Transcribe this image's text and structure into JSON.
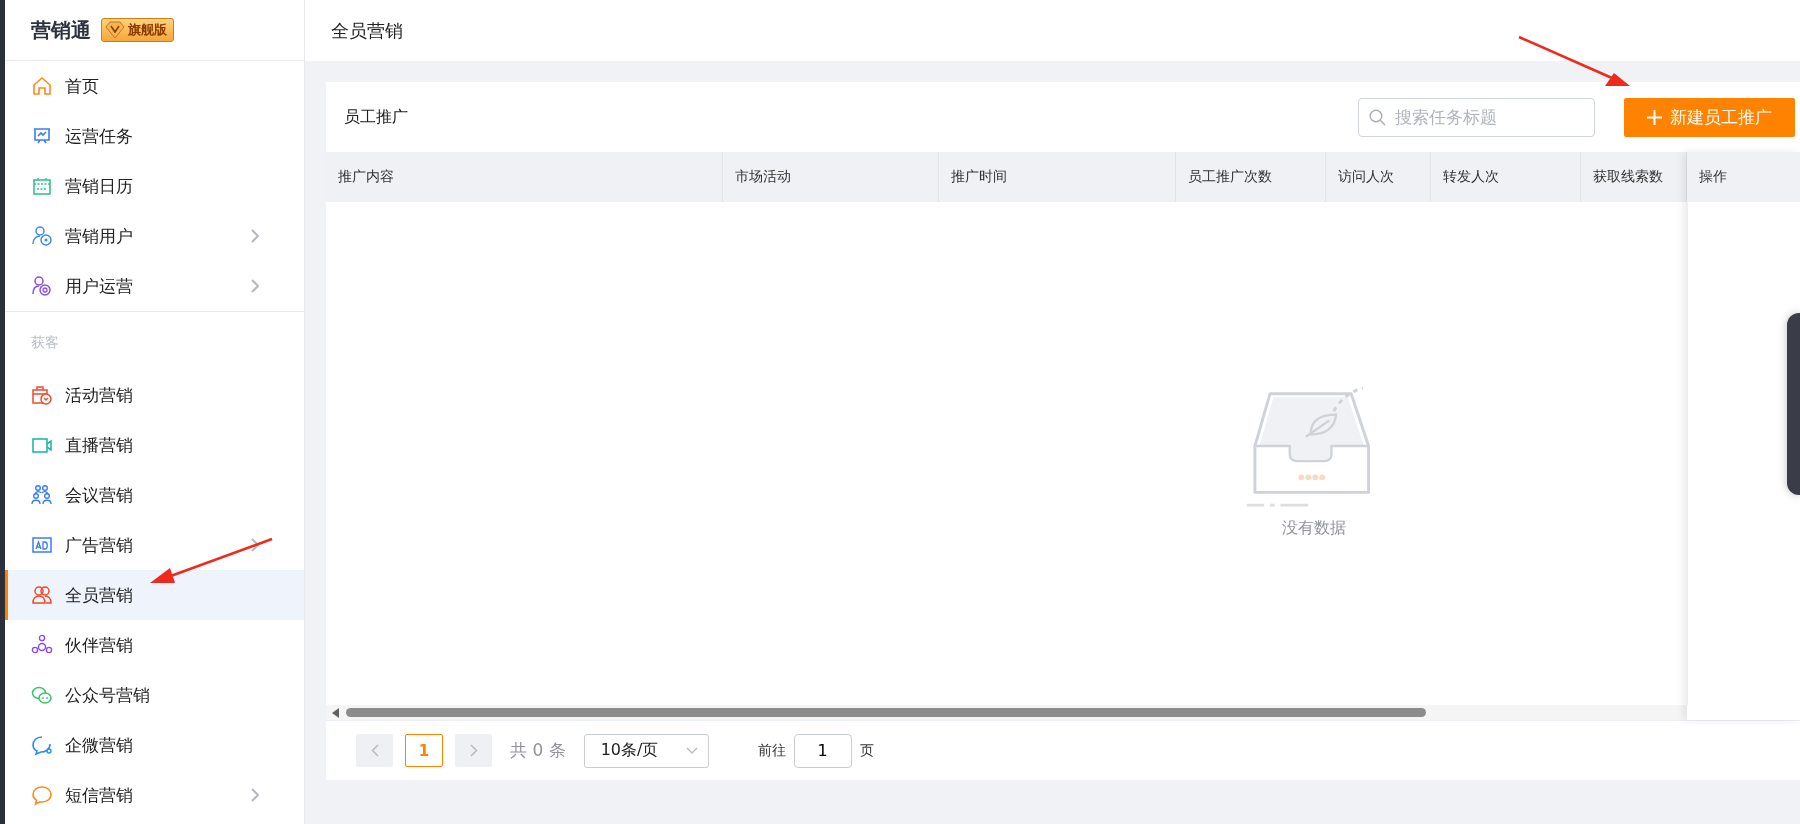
{
  "sidebar": {
    "brand": "营销通",
    "badge": "旗舰版",
    "groups": [
      {
        "items": [
          {
            "label": "首页",
            "expandable": false,
            "selected": false
          },
          {
            "label": "运营任务",
            "expandable": false,
            "selected": false
          },
          {
            "label": "营销日历",
            "expandable": false,
            "selected": false
          },
          {
            "label": "营销用户",
            "expandable": true,
            "selected": false
          },
          {
            "label": "用户运营",
            "expandable": true,
            "selected": false
          }
        ]
      },
      {
        "label": "获客",
        "items": [
          {
            "label": "活动营销",
            "expandable": false,
            "selected": false
          },
          {
            "label": "直播营销",
            "expandable": false,
            "selected": false
          },
          {
            "label": "会议营销",
            "expandable": false,
            "selected": false
          },
          {
            "label": "广告营销",
            "expandable": true,
            "selected": false
          },
          {
            "label": "全员营销",
            "expandable": false,
            "selected": true
          },
          {
            "label": "伙伴营销",
            "expandable": false,
            "selected": false
          },
          {
            "label": "公众号营销",
            "expandable": false,
            "selected": false
          },
          {
            "label": "企微营销",
            "expandable": false,
            "selected": false
          },
          {
            "label": "短信营销",
            "expandable": true,
            "selected": false
          }
        ]
      }
    ]
  },
  "header": {
    "title": "全员营销"
  },
  "card": {
    "title": "员工推广",
    "search": {
      "placeholder": "搜索任务标题"
    },
    "create_button": {
      "label": "新建员工推广"
    }
  },
  "table": {
    "columns": [
      "推广内容",
      "市场活动",
      "推广时间",
      "员工推广次数",
      "访问人次",
      "转发人次",
      "获取线索数"
    ],
    "fixed_column": "操作",
    "empty_text": "没有数据"
  },
  "pagination": {
    "pages": [
      {
        "label": "1",
        "selected": true
      }
    ],
    "total": "共 0 条",
    "page_size": "10条/页",
    "goto_label": "前往",
    "goto_value": "1",
    "page_suffix": "页"
  }
}
